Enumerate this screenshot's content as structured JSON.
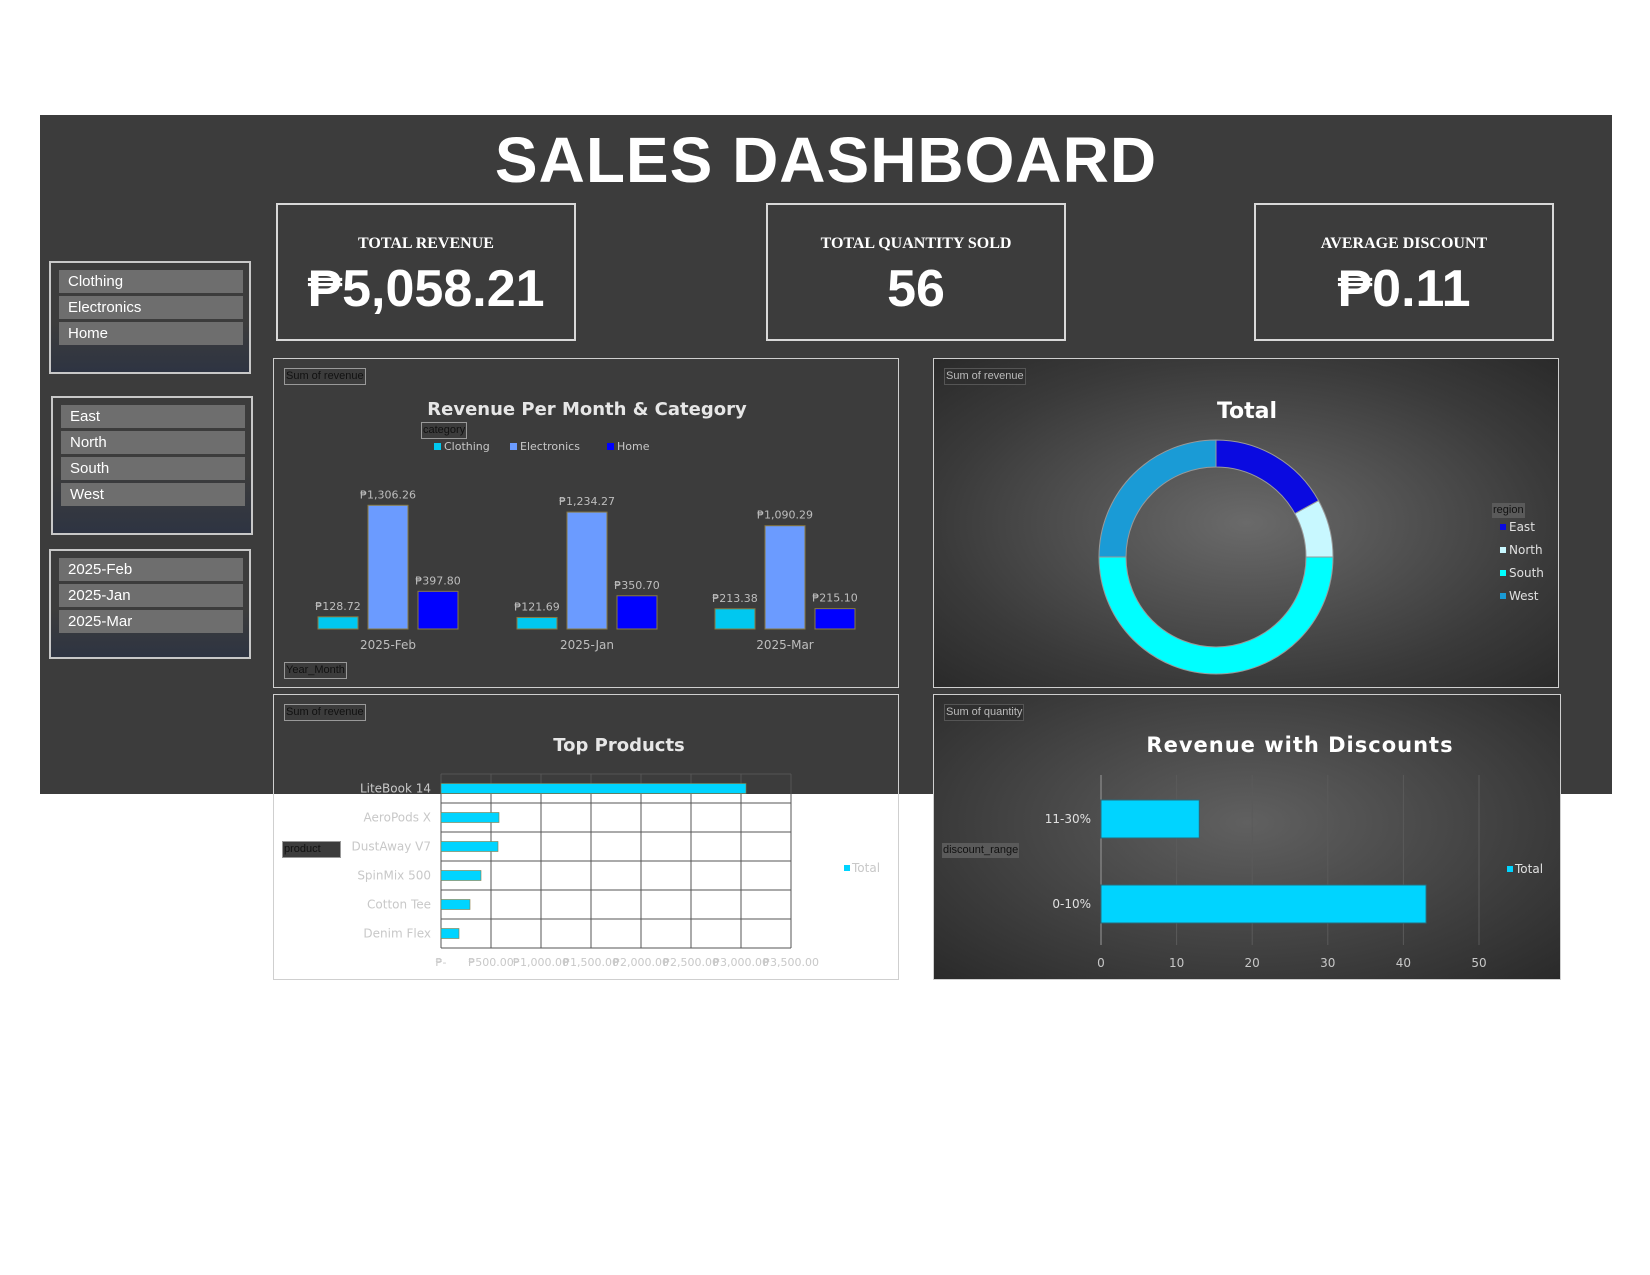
{
  "title": "SALES DASHBOARD",
  "kpis": {
    "revenue": {
      "label": "TOTAL REVENUE",
      "value": "₱5,058.21"
    },
    "quantity": {
      "label": "TOTAL QUANTITY SOLD",
      "value": "56"
    },
    "discount": {
      "label": "AVERAGE DISCOUNT",
      "value": "₱0.11"
    }
  },
  "slicers": {
    "category": [
      "Clothing",
      "Electronics",
      "Home"
    ],
    "region": [
      "East",
      "North",
      "South",
      "West"
    ],
    "month": [
      "2025-Feb",
      "2025-Jan",
      "2025-Mar"
    ]
  },
  "field_buttons": {
    "bar_values": "Sum of revenue",
    "bar_legend": "category",
    "bar_axis": "Year_Month",
    "donut_values": "Sum of revenue",
    "donut_legend": "region",
    "top_values": "Sum of revenue",
    "top_axis": "product",
    "disc_values": "Sum of quantity",
    "disc_axis": "discount_range"
  },
  "colors": {
    "background": "#3c3c3c",
    "clothing": "#00c8f0",
    "electronics": "#6b9bff",
    "home": "#0000ff",
    "east": "#0a0ae0",
    "north": "#c8f8ff",
    "south": "#00ffff",
    "west": "#1a9bd6",
    "bar_total": "#00d4ff"
  },
  "chart_data": [
    {
      "type": "bar",
      "title": "Revenue Per Month & Category",
      "categories": [
        "2025-Feb",
        "2025-Jan",
        "2025-Mar"
      ],
      "series": [
        {
          "name": "Clothing",
          "values": [
            128.72,
            121.69,
            213.38
          ],
          "labels": [
            "₱128.72",
            "₱121.69",
            "₱213.38"
          ]
        },
        {
          "name": "Electronics",
          "values": [
            1306.26,
            1234.27,
            1090.29
          ],
          "labels": [
            "₱1,306.26",
            "₱1,234.27",
            "₱1,090.29"
          ]
        },
        {
          "name": "Home",
          "values": [
            397.8,
            350.7,
            215.1
          ],
          "labels": [
            "₱397.80",
            "₱350.70",
            "₱215.10"
          ]
        }
      ],
      "ylim": [
        0,
        1400
      ]
    },
    {
      "type": "pie",
      "title": "Total",
      "donut": true,
      "categories": [
        "East",
        "North",
        "South",
        "West"
      ],
      "values": [
        0.17,
        0.08,
        0.5,
        0.25
      ],
      "legend": "right"
    },
    {
      "type": "bar",
      "orientation": "horizontal",
      "title": "Top Products",
      "categories": [
        "LiteBook 14",
        "AeroPods X",
        "DustAway V7",
        "SpinMix 500",
        "Cotton Tee",
        "Denim Flex"
      ],
      "series": [
        {
          "name": "Total",
          "values": [
            3050,
            580,
            570,
            400,
            290,
            180
          ]
        }
      ],
      "xlim": [
        0,
        3500
      ],
      "xticks": [
        "₱-",
        "₱500.00",
        "₱1,000.00",
        "₱1,500.00",
        "₱2,000.00",
        "₱2,500.00",
        "₱3,000.00",
        "₱3,500.00"
      ],
      "grid": true,
      "legend": "right"
    },
    {
      "type": "bar",
      "orientation": "horizontal",
      "title": "Revenue with Discounts",
      "categories": [
        "11-30%",
        "0-10%"
      ],
      "series": [
        {
          "name": "Total",
          "values": [
            13,
            43
          ]
        }
      ],
      "xlim": [
        0,
        50
      ],
      "xticks": [
        "0",
        "10",
        "20",
        "30",
        "40",
        "50"
      ],
      "grid": true,
      "legend": "right"
    }
  ]
}
